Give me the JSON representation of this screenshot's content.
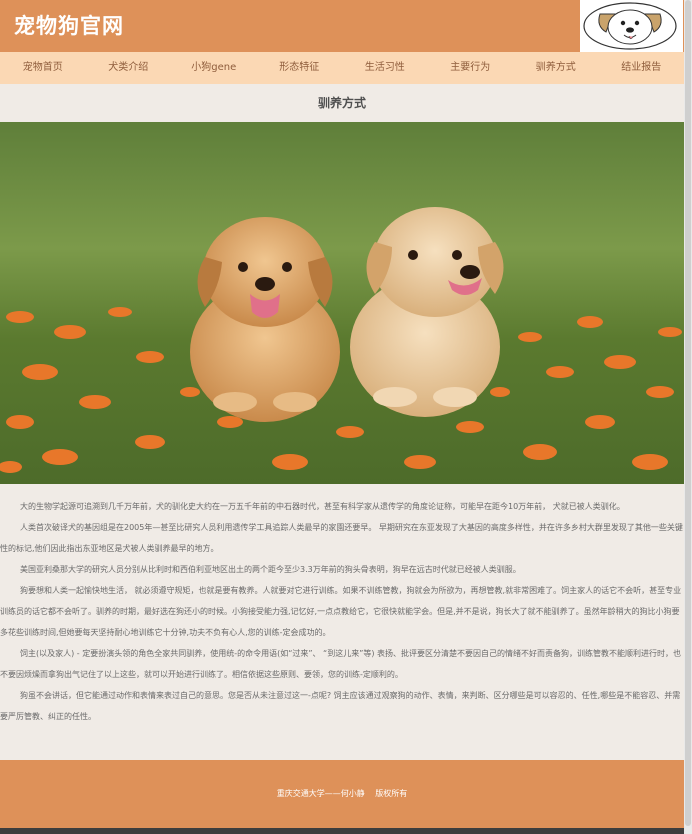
{
  "header": {
    "site_title": "宠物狗官网",
    "logo_icon": "dog-face-logo"
  },
  "nav": {
    "items": [
      {
        "label": "宠物首页"
      },
      {
        "label": "犬类介绍"
      },
      {
        "label": "小狗gene"
      },
      {
        "label": "形态特征"
      },
      {
        "label": "生活习性"
      },
      {
        "label": "主要行为"
      },
      {
        "label": "驯养方式"
      },
      {
        "label": "结业报告"
      }
    ]
  },
  "main": {
    "title": "驯养方式",
    "hero_image": "two-golden-retriever-puppies-in-flower-meadow",
    "paragraphs": [
      "大的生物学起源可追溯到几千万年前，犬的驯化史大约在一万五千年前的中石器时代，甚至有科学家从遗传学的角度论证称，可能早在距今10万年前， 犬就已被人类驯化。",
      "人类首次破译犬的基因组是在2005年—甚至比研究人员利用遗传学工具追踪人类最早的家園还要早。 早期研究在东亚发现了大基因的高度多样性，并在许多乡村大群里发现了其他一些关键性的标记,他们因此指出东亚地区是犬被人类驯养最早的地方。",
      "美国亚利桑那大学的研究人员分别从比利时和西伯利亚地区出土的两个距今至少3.3万年前的狗头骨表明，狗早在远古时代就已经被人类驯服。",
      "狗要想和人类一起愉快地生活， 就必须遵守规矩，也就是要有教养。人就要对它进行训练。如果不训练管教，狗就会为所欲为，再想管教,就非常困难了。饲主家人的话它不会听，甚至专业训练员的话它都不会听了。驯养的时期，最好选在狗还小的时候。小狗接受能力强,记忆好,一点点教给它，它很快就能学会。但是,并不是说，狗长大了就不能驯养了。虽然年龄稍大的狗比小狗要多花些训练时间,但她要每天坚持耐心地训练它十分钟,功夫不负有心人,您的训练-定会成功的。",
      "饲主(以及家人) - 定要扮演头领的角色全家共同驯养，使用统-的命令用语(如“过来”、 “到这儿来”等) 表扬、批评要区分清楚不要因自己的情绪不好而责备狗，训练管教不能顺利进行时，也不要因烦燥而拿狗出气记住了以上这些，就可以开始进行训练了。相信依据这些原则、要领，您的训练-定顺利的。",
      "狗虽不会讲话，但它能通过动作和表情来表过自己的意思。您是否从未注意过这一-点呢? 饲主应该通过观察狗的动作、表情，来判断、区分哪些是可以容忍的、任性,哪些是不能容忍、并需要严厉管教、纠正的任性。"
    ]
  },
  "footer": {
    "text": "重庆交通大学——何小静　 版权所有"
  },
  "colors": {
    "header_bg": "#de9159",
    "nav_bg": "#fbd8b4",
    "page_bg": "#f0ebe6"
  }
}
